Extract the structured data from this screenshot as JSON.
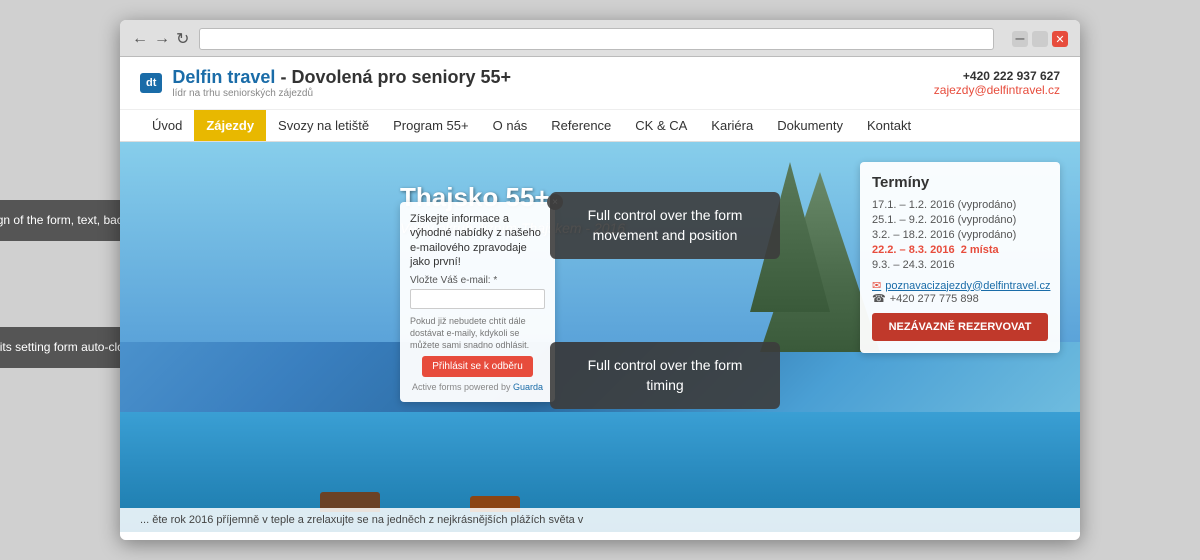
{
  "browser": {
    "back_btn": "←",
    "forward_btn": "→",
    "refresh_btn": "↻",
    "close_btn": "✕",
    "minimize_btn": "–",
    "maximize_btn": "□"
  },
  "site": {
    "logo_text": "dt",
    "logo_brand": "Delfin travel",
    "logo_tagline": "lídr na trhu seniorských zájezdů",
    "logo_dash": " - Dovolená pro seniory 55+",
    "phone": "+420 222 937 627",
    "email": "zajezdy@delfintravel.cz"
  },
  "nav": {
    "items": [
      {
        "label": "Úvod",
        "active": false
      },
      {
        "label": "Zájezdy",
        "active": true
      },
      {
        "label": "Svozy na letiště",
        "active": false
      },
      {
        "label": "Program 55+",
        "active": false
      },
      {
        "label": "O nás",
        "active": false
      },
      {
        "label": "Reference",
        "active": false
      },
      {
        "label": "CK & CA",
        "active": false
      },
      {
        "label": "Kariéra",
        "active": false
      },
      {
        "label": "Dokumenty",
        "active": false
      },
      {
        "label": "Kontakt",
        "active": false
      }
    ]
  },
  "hero": {
    "title": "Thajsko 55+",
    "subtitle": "Velký okruh Jižním Thajskem - 2016"
  },
  "terminy": {
    "heading": "Termíny",
    "dates": [
      {
        "text": "17.1. – 1.2. 2016 (vyprodáno)",
        "highlight": false
      },
      {
        "text": "25.1. – 9.2. 2016 (vyprodáno)",
        "highlight": false
      },
      {
        "text": "3.2. – 18.2. 2016 (vyprodáno)",
        "highlight": false
      },
      {
        "text": "22.2. – 8.3. 2016   2 místa",
        "highlight": true
      },
      {
        "text": "9.3. – 24.3. 2016",
        "highlight": false
      }
    ],
    "email": "poznavacizajezdy@delfintravel.cz",
    "phone": "+420 277 775 898",
    "reserve_btn": "NEZÁVAZNĚ REZERVOVAT"
  },
  "email_form": {
    "title": "Získejte informace a výhodné nabídky z našeho e-mailového zpravodaje jako první!",
    "label": "Vložte Váš e-mail: *",
    "note": "Pokud již nebudete chtít dále dostávat e-maily, kdykoli se můžete sami snadno odhlásit.",
    "submit_btn": "Přihlásit se k odběru",
    "powered_by": "Active forms powered by Guarda"
  },
  "tooltips": {
    "movement": "Full control over the form\nmovement and position",
    "timing": "Full control over the form timing"
  },
  "annotations": {
    "design": "Full control over the design\nof the form, text, background,\nframes, button and fields",
    "autoclosing": "Permits setting form\nauto-closing if inactive"
  },
  "bottom_bar": {
    "text": "... ěte rok 2016 příjemně v teple a zrelaxujte se na jedněch z nejkrásnějších plážích světa v"
  }
}
